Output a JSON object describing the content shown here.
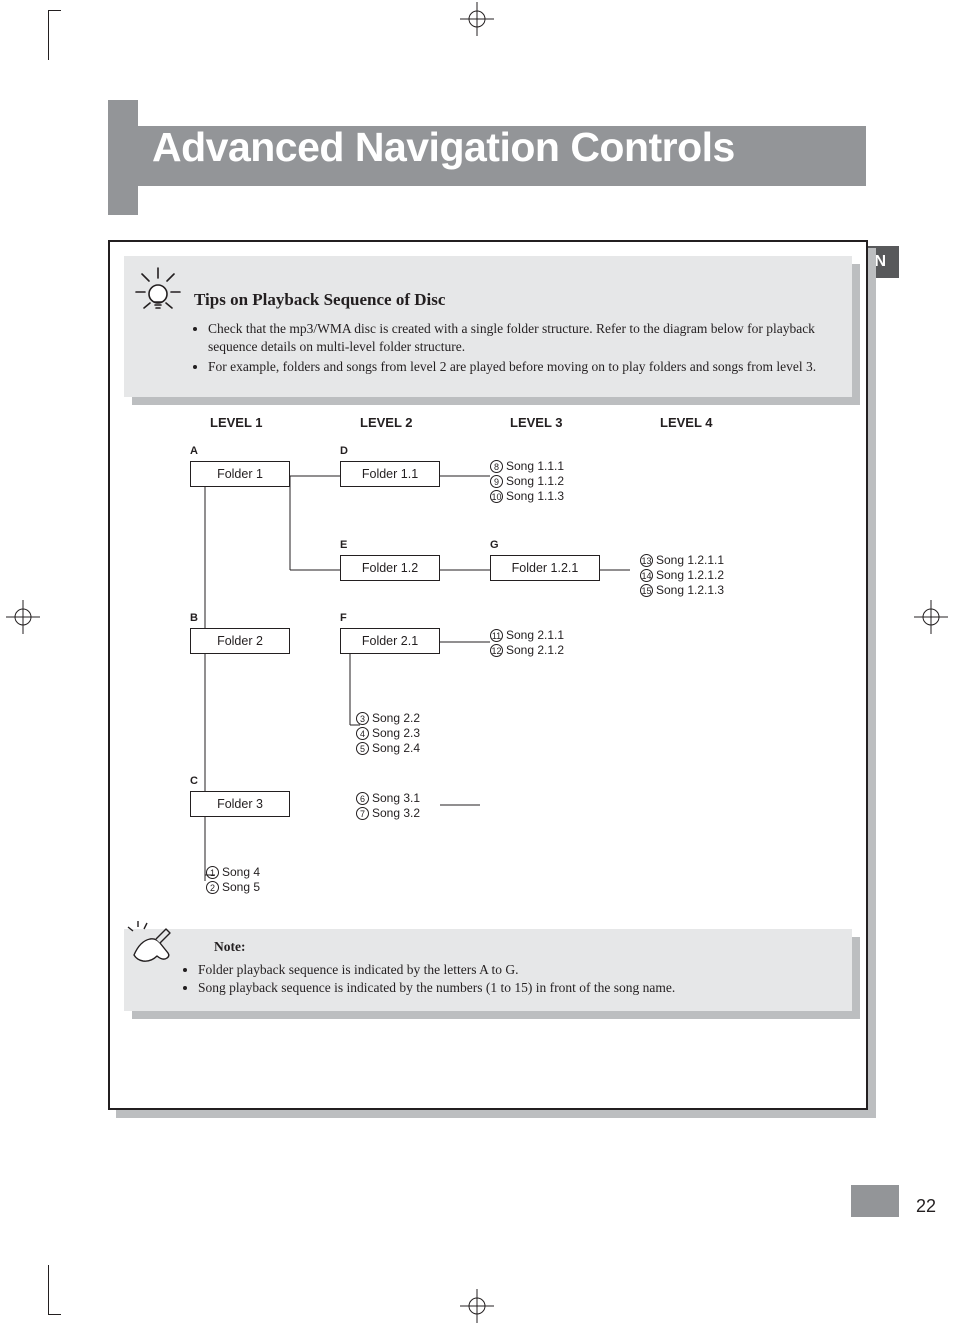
{
  "page_number": "22",
  "language": "EN",
  "title": "Advanced Navigation Controls",
  "tips": {
    "heading": "Tips on Playback Sequence of Disc",
    "bullets": [
      "Check that the mp3/WMA disc is created with a single folder structure. Refer to the diagram below for playback sequence details on multi-level folder structure.",
      "For example, folders and songs from level 2 are played before moving on to play folders and songs from level 3."
    ]
  },
  "levels": [
    "LEVEL 1",
    "LEVEL 2",
    "LEVEL 3",
    "LEVEL 4"
  ],
  "letters": {
    "A": "A",
    "B": "B",
    "C": "C",
    "D": "D",
    "E": "E",
    "F": "F",
    "G": "G"
  },
  "folders": {
    "f1": "Folder 1",
    "f11": "Folder 1.1",
    "f12": "Folder 1.2",
    "f121": "Folder 1.2.1",
    "f2": "Folder 2",
    "f21": "Folder 2.1",
    "f3": "Folder 3"
  },
  "songs": {
    "s111": {
      "n": "8",
      "t": "Song 1.1.1"
    },
    "s112": {
      "n": "9",
      "t": "Song 1.1.2"
    },
    "s113": {
      "n": "10",
      "t": "Song 1.1.3"
    },
    "s1211": {
      "n": "13",
      "t": "Song 1.2.1.1"
    },
    "s1212": {
      "n": "14",
      "t": "Song 1.2.1.2"
    },
    "s1213": {
      "n": "15",
      "t": "Song 1.2.1.3"
    },
    "s211": {
      "n": "11",
      "t": "Song 2.1.1"
    },
    "s212": {
      "n": "12",
      "t": "Song 2.1.2"
    },
    "s22": {
      "n": "3",
      "t": "Song 2.2"
    },
    "s23": {
      "n": "4",
      "t": "Song 2.3"
    },
    "s24": {
      "n": "5",
      "t": "Song 2.4"
    },
    "s31": {
      "n": "6",
      "t": "Song 3.1"
    },
    "s32": {
      "n": "7",
      "t": "Song 3.2"
    },
    "s4": {
      "n": "1",
      "t": "Song 4"
    },
    "s5": {
      "n": "2",
      "t": "Song 5"
    }
  },
  "note": {
    "heading": "Note:",
    "bullets": [
      "Folder playback sequence is indicated by the letters A to G.",
      "Song playback sequence is indicated by the numbers (1 to 15) in front of the song name."
    ]
  }
}
